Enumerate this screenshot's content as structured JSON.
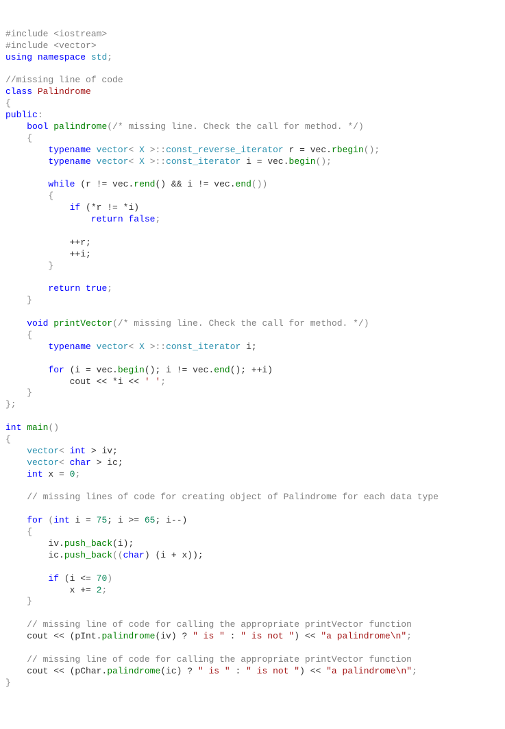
{
  "code": {
    "lines": [
      [
        {
          "t": "#include <iostream>",
          "c": "pp"
        }
      ],
      [
        {
          "t": "#include <vector>",
          "c": "pp"
        }
      ],
      [
        {
          "t": "using",
          "c": "kw"
        },
        {
          "t": " ",
          "c": "id"
        },
        {
          "t": "namespace",
          "c": "kw"
        },
        {
          "t": " ",
          "c": "id"
        },
        {
          "t": "std",
          "c": "ty"
        },
        {
          "t": ";",
          "c": "sym"
        }
      ],
      [],
      [
        {
          "t": "//missing line of code",
          "c": "cm"
        }
      ],
      [
        {
          "t": "class",
          "c": "kw"
        },
        {
          "t": " ",
          "c": "id"
        },
        {
          "t": "Palindrome",
          "c": "cls"
        }
      ],
      [
        {
          "t": "{",
          "c": "sym"
        }
      ],
      [
        {
          "t": "public",
          "c": "kw"
        },
        {
          "t": ":",
          "c": "sym"
        }
      ],
      [
        {
          "t": "    ",
          "c": "id"
        },
        {
          "t": "bool",
          "c": "kw"
        },
        {
          "t": " ",
          "c": "id"
        },
        {
          "t": "palindrome",
          "c": "fn"
        },
        {
          "t": "(",
          "c": "sym"
        },
        {
          "t": "/* missing line. Check the call for method. */",
          "c": "cm"
        },
        {
          "t": ")",
          "c": "sym"
        }
      ],
      [
        {
          "t": "    {",
          "c": "sym"
        }
      ],
      [
        {
          "t": "        ",
          "c": "id"
        },
        {
          "t": "typename",
          "c": "kw"
        },
        {
          "t": " ",
          "c": "id"
        },
        {
          "t": "vector",
          "c": "ty"
        },
        {
          "t": "< ",
          "c": "sym"
        },
        {
          "t": "X",
          "c": "ty"
        },
        {
          "t": " >::",
          "c": "sym"
        },
        {
          "t": "const_reverse_iterator",
          "c": "ty"
        },
        {
          "t": " r = vec.",
          "c": "id"
        },
        {
          "t": "rbegin",
          "c": "fn"
        },
        {
          "t": "();",
          "c": "sym"
        }
      ],
      [
        {
          "t": "        ",
          "c": "id"
        },
        {
          "t": "typename",
          "c": "kw"
        },
        {
          "t": " ",
          "c": "id"
        },
        {
          "t": "vector",
          "c": "ty"
        },
        {
          "t": "< ",
          "c": "sym"
        },
        {
          "t": "X",
          "c": "ty"
        },
        {
          "t": " >::",
          "c": "sym"
        },
        {
          "t": "const_iterator",
          "c": "ty"
        },
        {
          "t": " i = vec.",
          "c": "id"
        },
        {
          "t": "begin",
          "c": "fn"
        },
        {
          "t": "();",
          "c": "sym"
        }
      ],
      [],
      [
        {
          "t": "        ",
          "c": "id"
        },
        {
          "t": "while",
          "c": "kw"
        },
        {
          "t": " (r != vec.",
          "c": "id"
        },
        {
          "t": "rend",
          "c": "fn"
        },
        {
          "t": "() && i != vec.",
          "c": "id"
        },
        {
          "t": "end",
          "c": "fn"
        },
        {
          "t": "())",
          "c": "sym"
        }
      ],
      [
        {
          "t": "        {",
          "c": "sym"
        }
      ],
      [
        {
          "t": "            ",
          "c": "id"
        },
        {
          "t": "if",
          "c": "kw"
        },
        {
          "t": " (*r != *i)",
          "c": "id"
        }
      ],
      [
        {
          "t": "                ",
          "c": "id"
        },
        {
          "t": "return",
          "c": "kw"
        },
        {
          "t": " ",
          "c": "id"
        },
        {
          "t": "false",
          "c": "kw"
        },
        {
          "t": ";",
          "c": "sym"
        }
      ],
      [],
      [
        {
          "t": "            ++r;",
          "c": "id"
        }
      ],
      [
        {
          "t": "            ++i;",
          "c": "id"
        }
      ],
      [
        {
          "t": "        }",
          "c": "sym"
        }
      ],
      [],
      [
        {
          "t": "        ",
          "c": "id"
        },
        {
          "t": "return",
          "c": "kw"
        },
        {
          "t": " ",
          "c": "id"
        },
        {
          "t": "true",
          "c": "kw"
        },
        {
          "t": ";",
          "c": "sym"
        }
      ],
      [
        {
          "t": "    }",
          "c": "sym"
        }
      ],
      [],
      [
        {
          "t": "    ",
          "c": "id"
        },
        {
          "t": "void",
          "c": "kw"
        },
        {
          "t": " ",
          "c": "id"
        },
        {
          "t": "printVector",
          "c": "fn"
        },
        {
          "t": "(",
          "c": "sym"
        },
        {
          "t": "/* missing line. Check the call for method. */",
          "c": "cm"
        },
        {
          "t": ")",
          "c": "sym"
        }
      ],
      [
        {
          "t": "    {",
          "c": "sym"
        }
      ],
      [
        {
          "t": "        ",
          "c": "id"
        },
        {
          "t": "typename",
          "c": "kw"
        },
        {
          "t": " ",
          "c": "id"
        },
        {
          "t": "vector",
          "c": "ty"
        },
        {
          "t": "< ",
          "c": "sym"
        },
        {
          "t": "X",
          "c": "ty"
        },
        {
          "t": " >::",
          "c": "sym"
        },
        {
          "t": "const_iterator",
          "c": "ty"
        },
        {
          "t": " i;",
          "c": "id"
        }
      ],
      [],
      [
        {
          "t": "        ",
          "c": "id"
        },
        {
          "t": "for",
          "c": "kw"
        },
        {
          "t": " (i = vec.",
          "c": "id"
        },
        {
          "t": "begin",
          "c": "fn"
        },
        {
          "t": "(); i != vec.",
          "c": "id"
        },
        {
          "t": "end",
          "c": "fn"
        },
        {
          "t": "(); ++i)",
          "c": "id"
        }
      ],
      [
        {
          "t": "            cout << *i << ",
          "c": "id"
        },
        {
          "t": "' '",
          "c": "str"
        },
        {
          "t": ";",
          "c": "sym"
        }
      ],
      [
        {
          "t": "    }",
          "c": "sym"
        }
      ],
      [
        {
          "t": "};",
          "c": "sym"
        }
      ],
      [],
      [
        {
          "t": "int",
          "c": "kw"
        },
        {
          "t": " ",
          "c": "id"
        },
        {
          "t": "main",
          "c": "fn"
        },
        {
          "t": "()",
          "c": "sym"
        }
      ],
      [
        {
          "t": "{",
          "c": "sym"
        }
      ],
      [
        {
          "t": "    ",
          "c": "id"
        },
        {
          "t": "vector",
          "c": "ty"
        },
        {
          "t": "< ",
          "c": "sym"
        },
        {
          "t": "int",
          "c": "kw"
        },
        {
          "t": " > iv;",
          "c": "id"
        }
      ],
      [
        {
          "t": "    ",
          "c": "id"
        },
        {
          "t": "vector",
          "c": "ty"
        },
        {
          "t": "< ",
          "c": "sym"
        },
        {
          "t": "char",
          "c": "kw"
        },
        {
          "t": " > ic;",
          "c": "id"
        }
      ],
      [
        {
          "t": "    ",
          "c": "id"
        },
        {
          "t": "int",
          "c": "kw"
        },
        {
          "t": " x = ",
          "c": "id"
        },
        {
          "t": "0",
          "c": "num"
        },
        {
          "t": ";",
          "c": "sym"
        }
      ],
      [],
      [
        {
          "t": "    ",
          "c": "id"
        },
        {
          "t": "// missing lines of code for creating object of Palindrome for each data type",
          "c": "cm"
        }
      ],
      [],
      [
        {
          "t": "    ",
          "c": "id"
        },
        {
          "t": "for",
          "c": "kw"
        },
        {
          "t": " (",
          "c": "sym"
        },
        {
          "t": "int",
          "c": "kw"
        },
        {
          "t": " i = ",
          "c": "id"
        },
        {
          "t": "75",
          "c": "num"
        },
        {
          "t": "; i >= ",
          "c": "id"
        },
        {
          "t": "65",
          "c": "num"
        },
        {
          "t": "; i--)",
          "c": "id"
        }
      ],
      [
        {
          "t": "    {",
          "c": "sym"
        }
      ],
      [
        {
          "t": "        iv.",
          "c": "id"
        },
        {
          "t": "push_back",
          "c": "fn"
        },
        {
          "t": "(i);",
          "c": "id"
        }
      ],
      [
        {
          "t": "        ic.",
          "c": "id"
        },
        {
          "t": "push_back",
          "c": "fn"
        },
        {
          "t": "((",
          "c": "sym"
        },
        {
          "t": "char",
          "c": "kw"
        },
        {
          "t": ") (i + x));",
          "c": "id"
        }
      ],
      [],
      [
        {
          "t": "        ",
          "c": "id"
        },
        {
          "t": "if",
          "c": "kw"
        },
        {
          "t": " (i <= ",
          "c": "id"
        },
        {
          "t": "70",
          "c": "num"
        },
        {
          "t": ")",
          "c": "sym"
        }
      ],
      [
        {
          "t": "            x += ",
          "c": "id"
        },
        {
          "t": "2",
          "c": "num"
        },
        {
          "t": ";",
          "c": "sym"
        }
      ],
      [
        {
          "t": "    }",
          "c": "sym"
        }
      ],
      [],
      [
        {
          "t": "    ",
          "c": "id"
        },
        {
          "t": "// missing line of code for calling the appropriate printVector function",
          "c": "cm"
        }
      ],
      [
        {
          "t": "    cout << (pInt.",
          "c": "id"
        },
        {
          "t": "palindrome",
          "c": "fn"
        },
        {
          "t": "(iv) ? ",
          "c": "id"
        },
        {
          "t": "\" is \"",
          "c": "str"
        },
        {
          "t": " : ",
          "c": "id"
        },
        {
          "t": "\" is not \"",
          "c": "str"
        },
        {
          "t": ") << ",
          "c": "id"
        },
        {
          "t": "\"a palindrome\\n\"",
          "c": "str"
        },
        {
          "t": ";",
          "c": "sym"
        }
      ],
      [],
      [
        {
          "t": "    ",
          "c": "id"
        },
        {
          "t": "// missing line of code for calling the appropriate printVector function",
          "c": "cm"
        }
      ],
      [
        {
          "t": "    cout << (pChar.",
          "c": "id"
        },
        {
          "t": "palindrome",
          "c": "fn"
        },
        {
          "t": "(ic) ? ",
          "c": "id"
        },
        {
          "t": "\" is \"",
          "c": "str"
        },
        {
          "t": " : ",
          "c": "id"
        },
        {
          "t": "\" is not \"",
          "c": "str"
        },
        {
          "t": ") << ",
          "c": "id"
        },
        {
          "t": "\"a palindrome\\n\"",
          "c": "str"
        },
        {
          "t": ";",
          "c": "sym"
        }
      ],
      [
        {
          "t": "}",
          "c": "sym"
        }
      ]
    ]
  }
}
